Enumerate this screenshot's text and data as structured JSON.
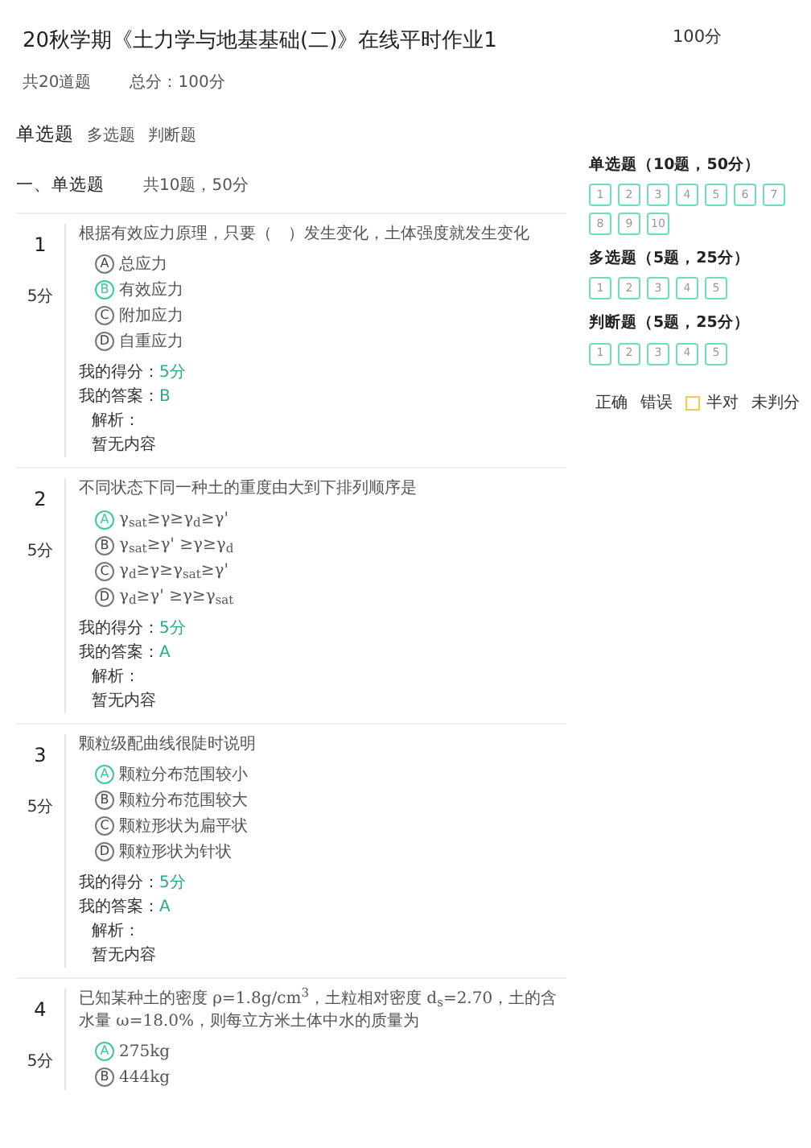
{
  "header": {
    "title": "20秋学期《土力学与地基基础(二)》在线平时作业1",
    "question_count": "共20道题",
    "total": "总分：100分"
  },
  "score": "100分",
  "tabs": [
    {
      "label": "单选题",
      "selected": true
    },
    {
      "label": "多选题",
      "selected": false
    },
    {
      "label": "判断题",
      "selected": false
    }
  ],
  "section": {
    "title": "一、单选题",
    "info": "共10题，50分"
  },
  "questions": [
    {
      "number": "1",
      "points": "5分",
      "stem": "根据有效应力原理，只要（　）发生变化，土体强度就发生变化",
      "options": [
        {
          "letter": "A",
          "text": "总应力",
          "selected": false
        },
        {
          "letter": "B",
          "text": "有效应力",
          "selected": true
        },
        {
          "letter": "C",
          "text": "附加应力",
          "selected": false
        },
        {
          "letter": "D",
          "text": "自重应力",
          "selected": false
        }
      ],
      "score_label": "我的得分：",
      "score": "5分",
      "answer_label": "我的答案：",
      "answer": "B",
      "analysis_label": "解析：",
      "analysis": "暂无内容"
    },
    {
      "number": "2",
      "points": "5分",
      "stem": "不同状态下同一种土的重度由大到下排列顺序是",
      "options": [
        {
          "letter": "A",
          "text": "γ$_{sat}$≥γ≥γ$_{d}$≥γ'",
          "selected": true
        },
        {
          "letter": "B",
          "text": "γ$_{sat}$≥γ' ≥γ≥γ$_{d}$",
          "selected": false
        },
        {
          "letter": "C",
          "text": "γ$_{d}$≥γ≥γ$_{sat}$≥γ'",
          "selected": false
        },
        {
          "letter": "D",
          "text": "γ$_{d}$≥γ' ≥γ≥γ$_{sat}$",
          "selected": false
        }
      ],
      "score_label": "我的得分：",
      "score": "5分",
      "answer_label": "我的答案：",
      "answer": "A",
      "analysis_label": "解析：",
      "analysis": "暂无内容"
    },
    {
      "number": "3",
      "points": "5分",
      "stem": "颗粒级配曲线很陡时说明",
      "options": [
        {
          "letter": "A",
          "text": "颗粒分布范围较小",
          "selected": true
        },
        {
          "letter": "B",
          "text": "颗粒分布范围较大",
          "selected": false
        },
        {
          "letter": "C",
          "text": "颗粒形状为扁平状",
          "selected": false
        },
        {
          "letter": "D",
          "text": "颗粒形状为针状",
          "selected": false
        }
      ],
      "score_label": "我的得分：",
      "score": "5分",
      "answer_label": "我的答案：",
      "answer": "A",
      "analysis_label": "解析：",
      "analysis": "暂无内容"
    },
    {
      "number": "4",
      "points": "5分",
      "stem": "已知某种土的密度 ρ=1.8g/cm$^{3}$，土粒相对密度 d$_{s}$=2.70，土的含水量 ω=18.0%，则每立方米土体中水的质量为",
      "options": [
        {
          "letter": "A",
          "text": "275kg",
          "selected": true
        },
        {
          "letter": "B",
          "text": "444kg",
          "selected": false
        }
      ]
    }
  ],
  "answer_card": [
    {
      "title": "单选题（10题，50分）",
      "items": [
        "1",
        "2",
        "3",
        "4",
        "5",
        "6",
        "7",
        "8",
        "9",
        "10"
      ]
    },
    {
      "title": "多选题（5题，25分）",
      "items": [
        "1",
        "2",
        "3",
        "4",
        "5"
      ]
    },
    {
      "title": "判断题（5题，25分）",
      "items": [
        "1",
        "2",
        "3",
        "4",
        "5"
      ]
    }
  ],
  "legend": [
    {
      "label": "正确"
    },
    {
      "label": "错误"
    },
    {
      "label": "半对",
      "color": "#f2cf4a"
    },
    {
      "label": "未判分"
    }
  ]
}
